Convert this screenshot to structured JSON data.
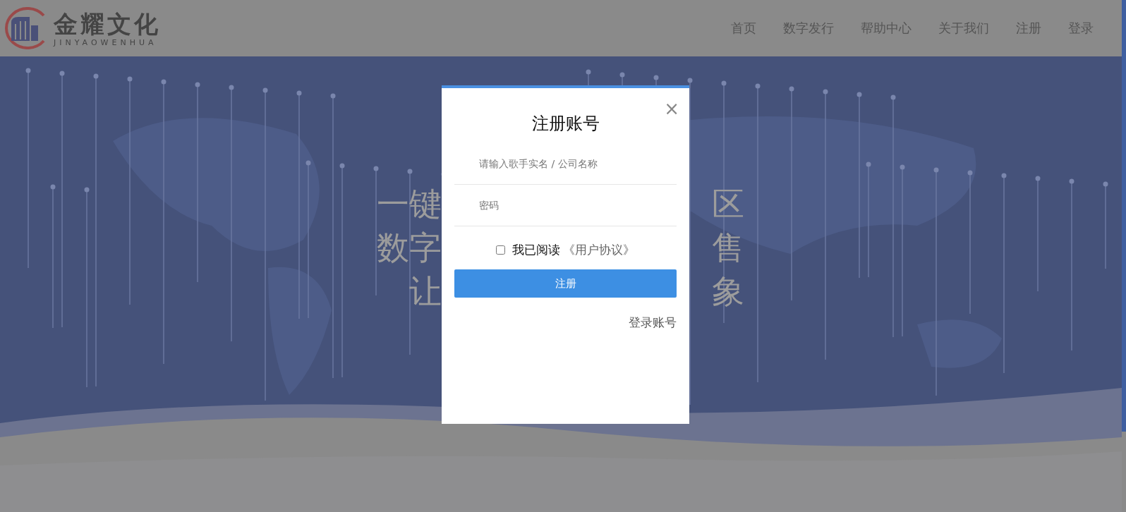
{
  "header": {
    "logo": {
      "name": "金耀文化",
      "subtitle": "JINYAOWENHUA"
    },
    "nav": [
      "首页",
      "数字发行",
      "帮助中心",
      "关于我们",
      "注册",
      "登录"
    ]
  },
  "hero": {
    "left_lines": [
      "一键",
      "数字",
      "让"
    ],
    "right_lines": [
      "区",
      "售",
      "象"
    ]
  },
  "modal": {
    "title": "注册账号",
    "close": "×",
    "fields": [
      {
        "placeholder": "请输入歌手实名 / 公司名称"
      },
      {
        "placeholder": "密码"
      }
    ],
    "agreement": {
      "checked": false,
      "text": "我已阅读",
      "link": "《用户协议》"
    },
    "submit": "注册",
    "login_link": "登录账号"
  }
}
